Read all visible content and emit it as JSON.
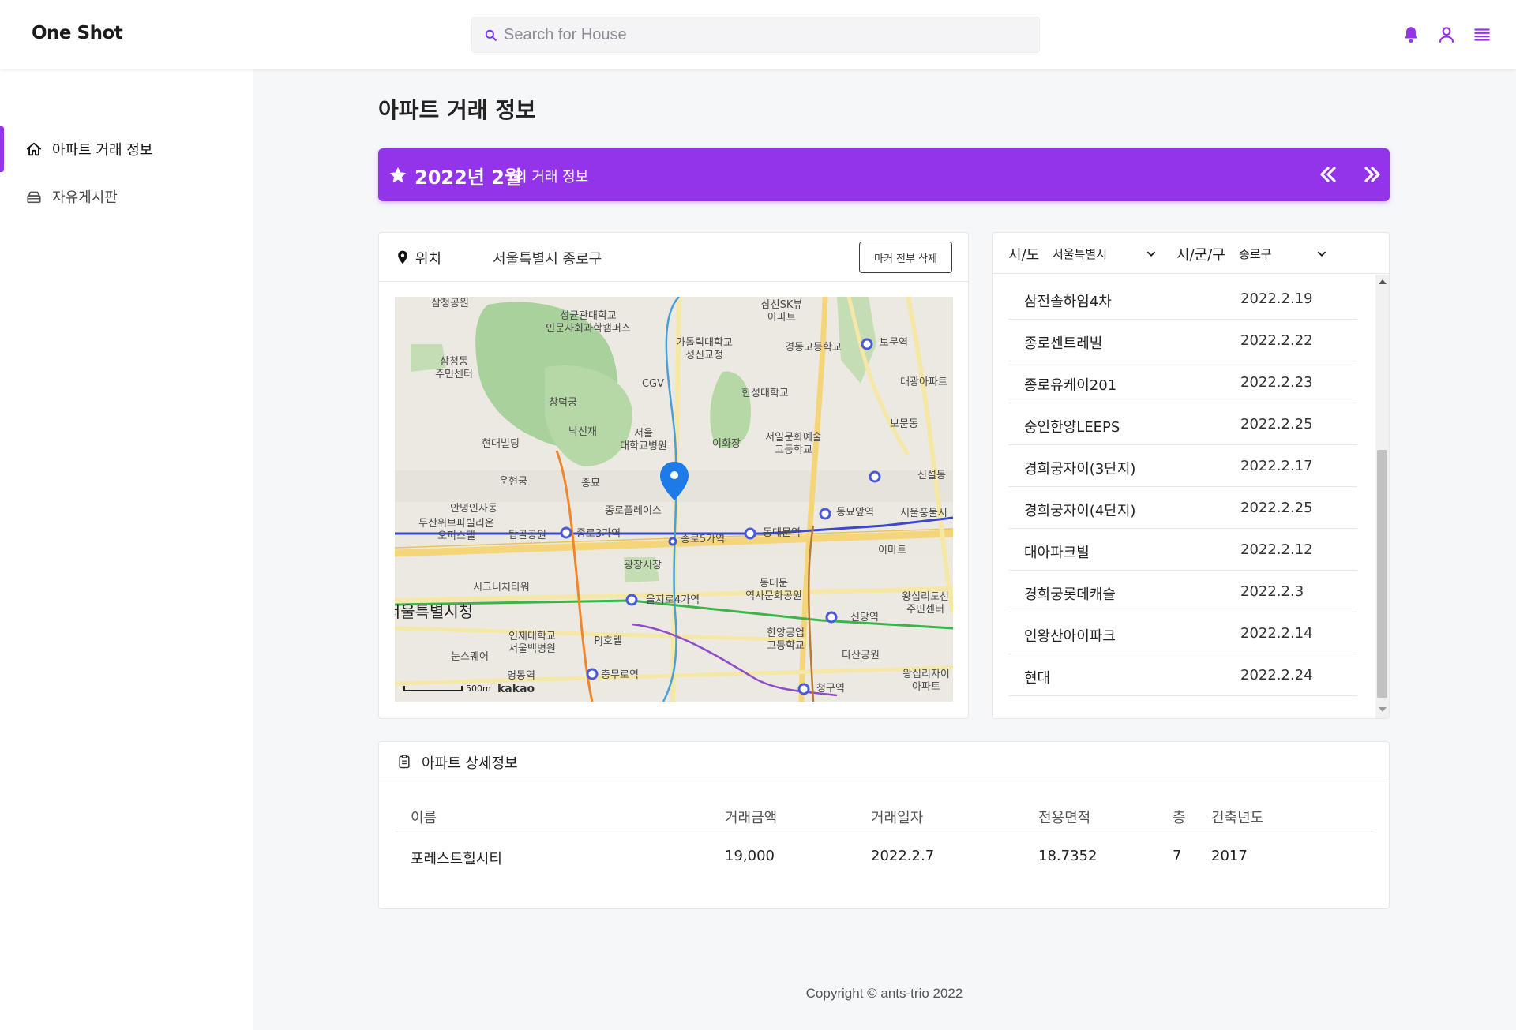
{
  "header": {
    "brand": "One Shot",
    "search_placeholder": "Search for House"
  },
  "sidebar": {
    "items": [
      {
        "label": "아파트 거래 정보",
        "active": true
      },
      {
        "label": "자유게시판",
        "active": false
      }
    ]
  },
  "main": {
    "title": "아파트 거래 정보",
    "banner": {
      "period": "2022년 2월",
      "suffix": "의 거래 정보"
    },
    "map_card": {
      "location_label": "위치",
      "location_value": "서울특별시 종로구",
      "clear_button": "마커 전부 삭제",
      "scale_label": "500m",
      "map_brand": "kakao",
      "labels": [
        "삼청공원",
        "성균관대학교",
        "인문사회과학캠퍼스",
        "삼선SK뷰",
        "아파트",
        "삼청동",
        "주민센터",
        "가톨릭대학교",
        "성신교정",
        "경동고등학교",
        "보문역",
        "대광아파트",
        "CGV",
        "창덕궁",
        "한성대학교",
        "낙선재",
        "서울",
        "대학교병원",
        "이화장",
        "서일문화예술",
        "고등학교",
        "보문동",
        "현대빌딩",
        "운현궁",
        "종묘",
        "신설동",
        "안녕인사동",
        "종로플레이스",
        "동묘앞역",
        "서울풍물시",
        "두산위브파빌리온",
        "오피스텔",
        "탑골공원",
        "종로3가역",
        "종로5가역",
        "동대문역",
        "광장시장",
        "이마트",
        "시그니처타워",
        "동대문",
        "역사문화공원",
        "왕십리도선",
        "주민센터",
        "을지로4가역",
        "서울특별시청",
        "신당역",
        "인제대학교",
        "서울백병원",
        "PJ호텔",
        "한양공업",
        "고등학교",
        "다산공원",
        "눈스퀘어",
        "명동역",
        "충무로역",
        "청구역",
        "왕십리자이",
        "아파트"
      ]
    },
    "region": {
      "sido_label": "시/도",
      "sido_value": "서울특별시",
      "gugun_label": "시/군/구",
      "gugun_value": "종로구"
    },
    "deals": [
      {
        "name": "삼전솔하임4차",
        "date": "2022.2.19"
      },
      {
        "name": "종로센트레빌",
        "date": "2022.2.22"
      },
      {
        "name": "종로유케이201",
        "date": "2022.2.23"
      },
      {
        "name": "숭인한양LEEPS",
        "date": "2022.2.25"
      },
      {
        "name": "경희궁자이(3단지)",
        "date": "2022.2.17"
      },
      {
        "name": "경희궁자이(4단지)",
        "date": "2022.2.25"
      },
      {
        "name": "대아파크빌",
        "date": "2022.2.12"
      },
      {
        "name": "경희궁롯데캐슬",
        "date": "2022.2.3"
      },
      {
        "name": "인왕산아이파크",
        "date": "2022.2.14"
      },
      {
        "name": "현대",
        "date": "2022.2.24"
      }
    ],
    "detail": {
      "title": "아파트 상세정보",
      "columns": [
        "이름",
        "거래금액",
        "거래일자",
        "전용면적",
        "층",
        "건축년도"
      ],
      "row": [
        "포레스트힐시티",
        "19,000",
        "2022.2.7",
        "18.7352",
        "7",
        "2017"
      ]
    }
  },
  "footer": {
    "text": "Copyright © ants-trio 2022"
  },
  "colors": {
    "accent": "#9333ea",
    "map_pin": "#1e7ae6"
  },
  "icons": [
    "search-icon",
    "bell-icon",
    "user-icon",
    "menu-icon",
    "home-icon",
    "board-icon",
    "star-icon",
    "double-chevron-left-icon",
    "double-chevron-right-icon",
    "map-pin-icon",
    "chevron-down-icon",
    "clipboard-icon"
  ]
}
